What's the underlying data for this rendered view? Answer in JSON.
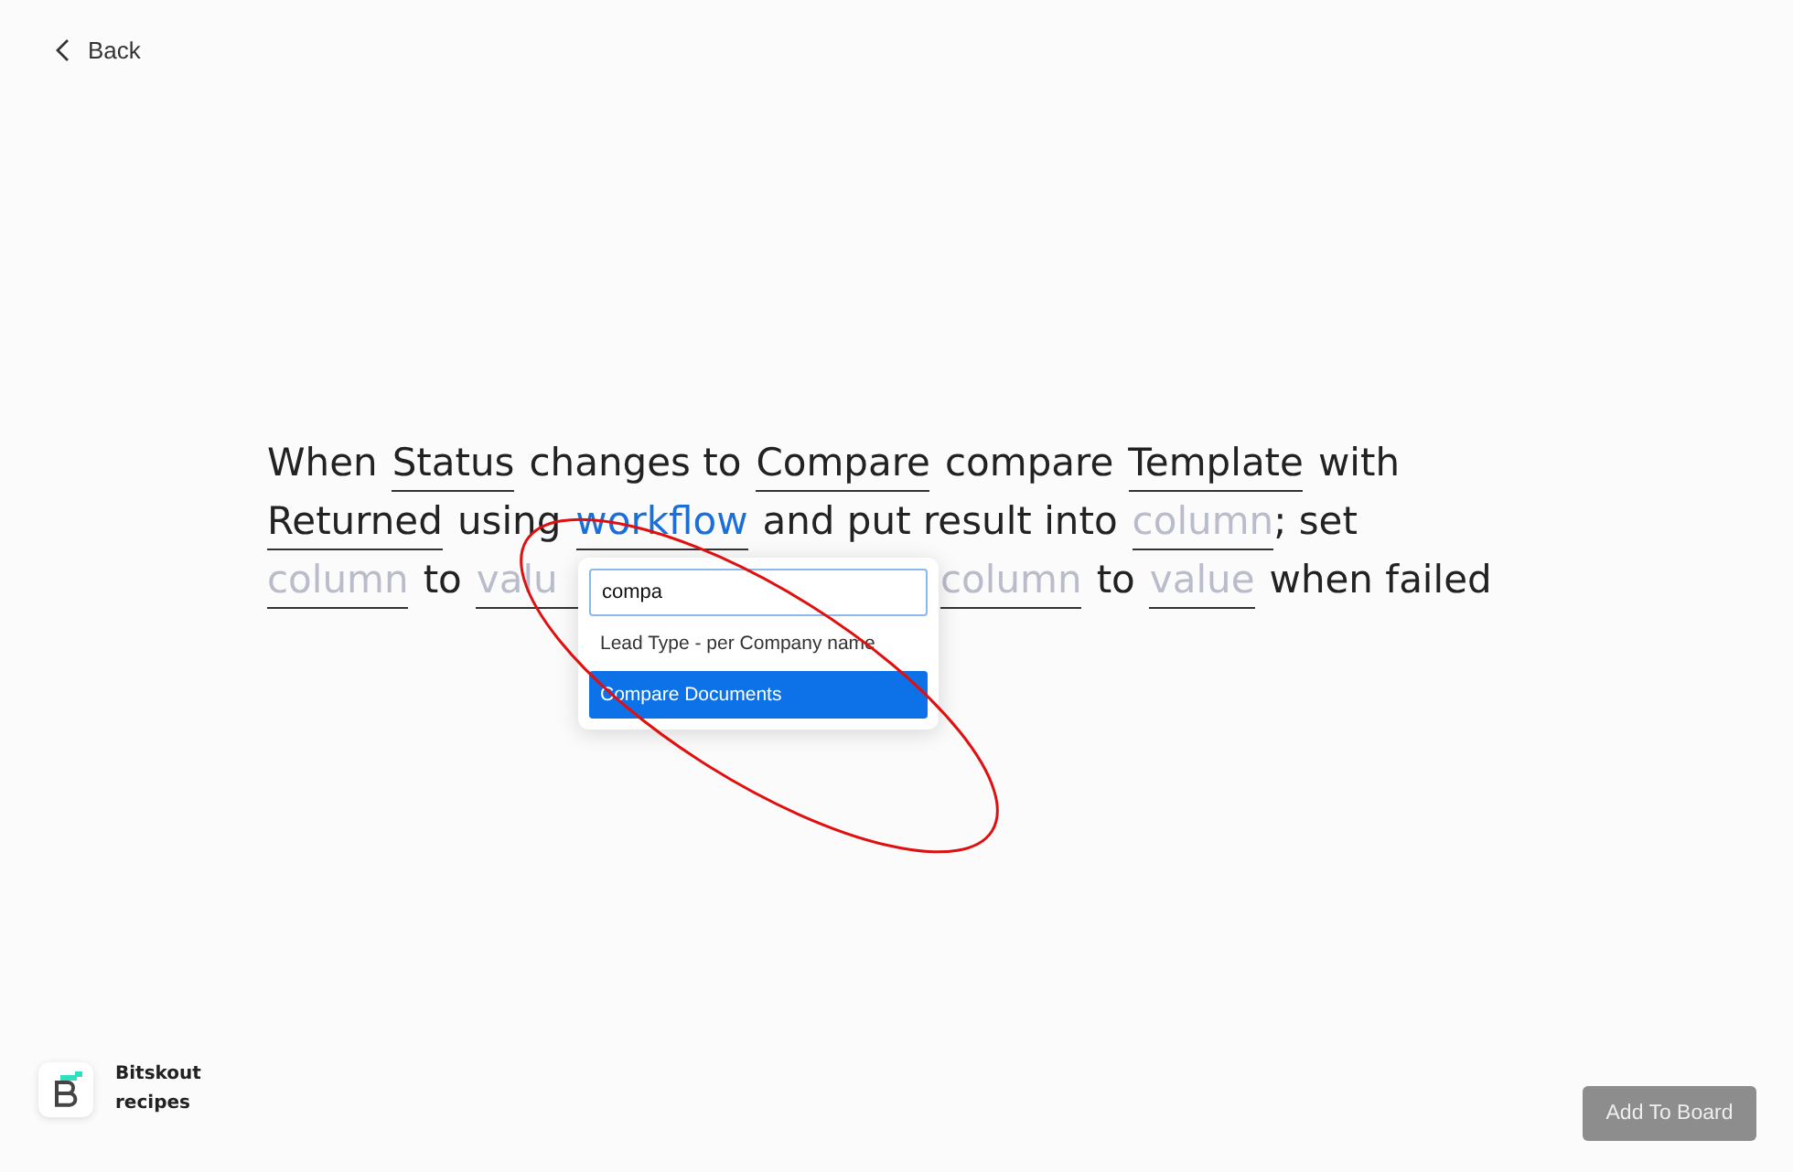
{
  "back": {
    "label": "Back"
  },
  "sentence": {
    "lines": [
      [
        {
          "text": "When",
          "kind": "plain"
        },
        {
          "text": "Status",
          "kind": "filled"
        },
        {
          "text": "changes to",
          "kind": "plain"
        },
        {
          "text": "Compare",
          "kind": "filled"
        },
        {
          "text": "compare",
          "kind": "plain"
        },
        {
          "text": "Template",
          "kind": "filled"
        },
        {
          "text": "with",
          "kind": "plain"
        }
      ],
      [
        {
          "text": "Returned",
          "kind": "filled"
        },
        {
          "text": "using",
          "kind": "plain"
        },
        {
          "text": "workflow",
          "kind": "active"
        },
        {
          "text": "and put result into",
          "kind": "plain"
        },
        {
          "text": "column",
          "kind": "empty"
        },
        {
          "text": "; set",
          "kind": "punct"
        }
      ],
      [
        {
          "text": "column",
          "kind": "empty"
        },
        {
          "text": "to",
          "kind": "plain"
        },
        {
          "text": "valu",
          "kind": "cut"
        },
        {
          "text": "column",
          "kind": "empty"
        },
        {
          "text": "to",
          "kind": "plain"
        },
        {
          "text": "value",
          "kind": "empty"
        },
        {
          "text": "when failed",
          "kind": "plain"
        }
      ]
    ]
  },
  "dropdown": {
    "search": {
      "value": "compa"
    },
    "options": [
      {
        "label": "Lead Type - per Company name",
        "selected": false
      },
      {
        "label": "Compare Documents",
        "selected": true
      }
    ]
  },
  "brand": {
    "name": "Bitskout recipes"
  },
  "add_button": {
    "label": "Add To Board",
    "disabled": true
  }
}
